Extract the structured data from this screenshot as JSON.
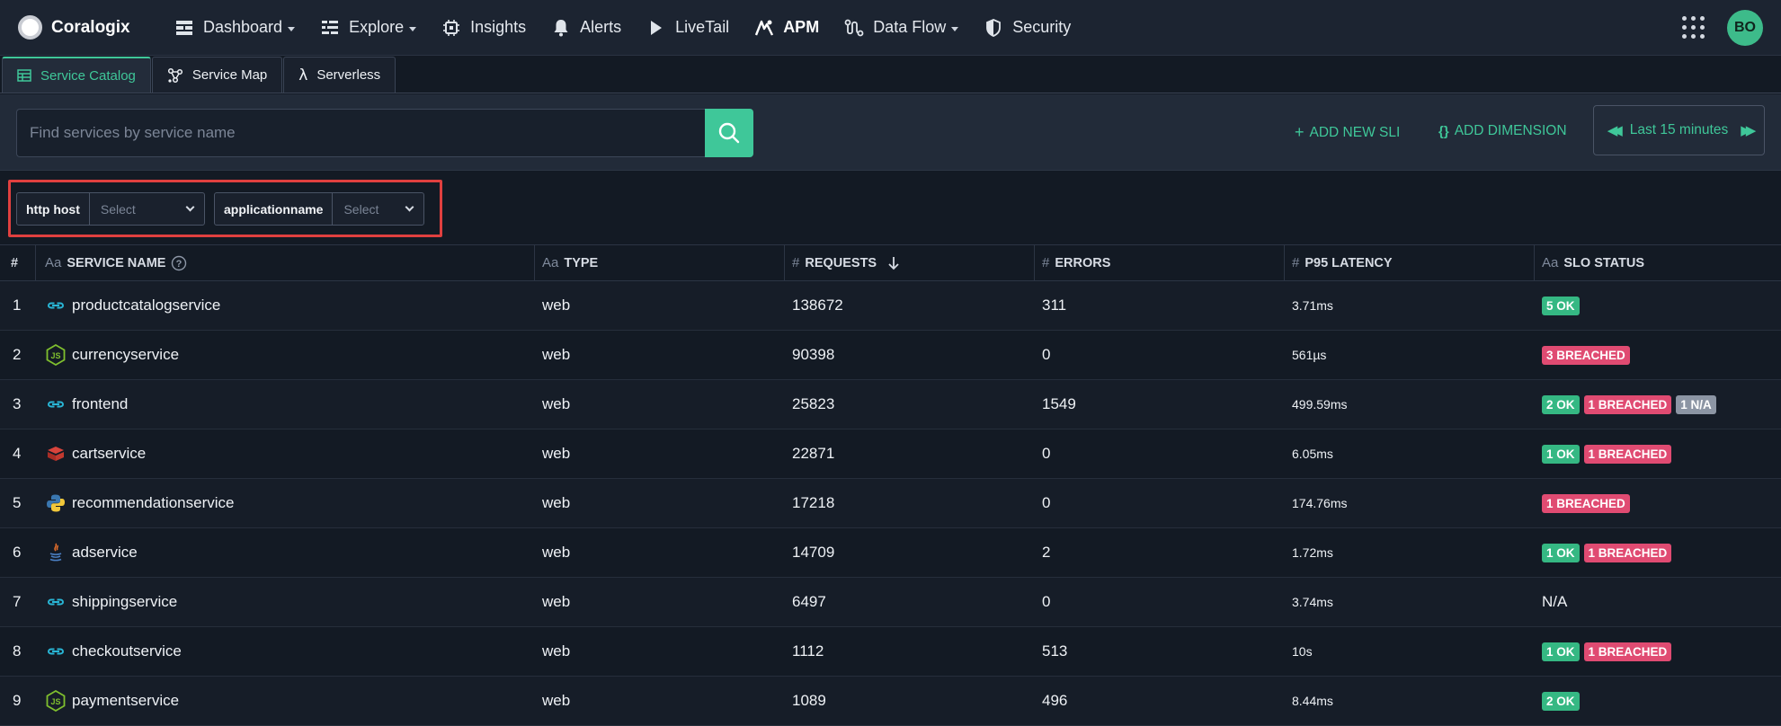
{
  "app": {
    "name": "Coralogix"
  },
  "nav": {
    "items": [
      {
        "label": "Dashboard",
        "icon": "dashboard-icon",
        "caret": true
      },
      {
        "label": "Explore",
        "icon": "explore-icon",
        "caret": true
      },
      {
        "label": "Insights",
        "icon": "insights-icon",
        "caret": false
      },
      {
        "label": "Alerts",
        "icon": "bell-icon",
        "caret": false
      },
      {
        "label": "LiveTail",
        "icon": "play-icon",
        "caret": false
      },
      {
        "label": "APM",
        "icon": "apm-icon",
        "caret": false,
        "active": true
      },
      {
        "label": "Data Flow",
        "icon": "data-flow-icon",
        "caret": true
      },
      {
        "label": "Security",
        "icon": "shield-icon",
        "caret": false
      }
    ],
    "avatar": "BO"
  },
  "tabs": [
    {
      "label": "Service Catalog",
      "icon": "table-icon",
      "active": true
    },
    {
      "label": "Service Map",
      "icon": "graph-icon",
      "active": false
    },
    {
      "label": "Serverless",
      "icon": "lambda-icon",
      "active": false
    }
  ],
  "search": {
    "placeholder": "Find services by service name",
    "add_sli": "ADD NEW SLI",
    "add_dimension": "ADD DIMENSION",
    "time_range": "Last 15 minutes"
  },
  "filters": [
    {
      "label": "http host",
      "placeholder": "Select"
    },
    {
      "label": "applicationname",
      "placeholder": "Select"
    }
  ],
  "table": {
    "columns": {
      "num": "#",
      "name": "SERVICE NAME",
      "type": "TYPE",
      "requests": "REQUESTS",
      "errors": "ERRORS",
      "latency": "P95 LATENCY",
      "slo": "SLO STATUS"
    },
    "type_prefix_text": "Aa",
    "type_prefix_num": "#",
    "rows": [
      {
        "num": "1",
        "name": "productcatalogservice",
        "icon": "go-icon",
        "type": "web",
        "requests": "138672",
        "errors": "311",
        "latency": "3.71ms",
        "slo": [
          {
            "text": "5 OK",
            "kind": "ok"
          }
        ],
        "slo_text": ""
      },
      {
        "num": "2",
        "name": "currencyservice",
        "icon": "nodejs-icon",
        "type": "web",
        "requests": "90398",
        "errors": "0",
        "latency": "561µs",
        "slo": [
          {
            "text": "3 BREACHED",
            "kind": "breached"
          }
        ],
        "slo_text": ""
      },
      {
        "num": "3",
        "name": "frontend",
        "icon": "go-icon",
        "type": "web",
        "requests": "25823",
        "errors": "1549",
        "latency": "499.59ms",
        "slo": [
          {
            "text": "2 OK",
            "kind": "ok"
          },
          {
            "text": "1 BREACHED",
            "kind": "breached"
          },
          {
            "text": "1 N/A",
            "kind": "na"
          }
        ],
        "slo_text": ""
      },
      {
        "num": "4",
        "name": "cartservice",
        "icon": "dotnet-icon",
        "type": "web",
        "requests": "22871",
        "errors": "0",
        "latency": "6.05ms",
        "slo": [
          {
            "text": "1 OK",
            "kind": "ok"
          },
          {
            "text": "1 BREACHED",
            "kind": "breached"
          }
        ],
        "slo_text": ""
      },
      {
        "num": "5",
        "name": "recommendationservice",
        "icon": "python-icon",
        "type": "web",
        "requests": "17218",
        "errors": "0",
        "latency": "174.76ms",
        "slo": [
          {
            "text": "1 BREACHED",
            "kind": "breached"
          }
        ],
        "slo_text": ""
      },
      {
        "num": "6",
        "name": "adservice",
        "icon": "java-icon",
        "type": "web",
        "requests": "14709",
        "errors": "2",
        "latency": "1.72ms",
        "slo": [
          {
            "text": "1 OK",
            "kind": "ok"
          },
          {
            "text": "1 BREACHED",
            "kind": "breached"
          }
        ],
        "slo_text": ""
      },
      {
        "num": "7",
        "name": "shippingservice",
        "icon": "go-icon",
        "type": "web",
        "requests": "6497",
        "errors": "0",
        "latency": "3.74ms",
        "slo": [],
        "slo_text": "N/A"
      },
      {
        "num": "8",
        "name": "checkoutservice",
        "icon": "go-icon",
        "type": "web",
        "requests": "1112",
        "errors": "513",
        "latency": "10s",
        "slo": [
          {
            "text": "1 OK",
            "kind": "ok"
          },
          {
            "text": "1 BREACHED",
            "kind": "breached"
          }
        ],
        "slo_text": ""
      },
      {
        "num": "9",
        "name": "paymentservice",
        "icon": "nodejs-icon",
        "type": "web",
        "requests": "1089",
        "errors": "496",
        "latency": "8.44ms",
        "slo": [
          {
            "text": "2 OK",
            "kind": "ok"
          }
        ],
        "slo_text": ""
      }
    ]
  }
}
